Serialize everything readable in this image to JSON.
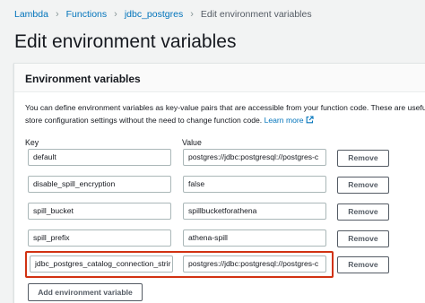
{
  "breadcrumb": {
    "items": [
      "Lambda",
      "Functions",
      "jdbc_postgres"
    ],
    "current": "Edit environment variables",
    "separator": "›"
  },
  "page": {
    "title": "Edit environment variables"
  },
  "panel": {
    "title": "Environment variables",
    "description_line1": "You can define environment variables as key-value pairs that are accessible from your function code. These are useful to",
    "description_line2": "store configuration settings without the need to change function code.",
    "learn_more": "Learn more",
    "key_header": "Key",
    "value_header": "Value",
    "remove_label": "Remove",
    "add_label": "Add environment variable"
  },
  "variables": [
    {
      "key": "default",
      "value": "postgres://jdbc:postgresql://postgres-c"
    },
    {
      "key": "disable_spill_encryption",
      "value": "false"
    },
    {
      "key": "spill_bucket",
      "value": "spillbucketforathena"
    },
    {
      "key": "spill_prefix",
      "value": "athena-spill"
    },
    {
      "key": "jdbc_postgres_catalog_connection_strir",
      "value": "postgres://jdbc:postgresql://postgres-c"
    }
  ],
  "colors": {
    "link": "#0073bb",
    "highlight": "#d13212",
    "button_border": "#545b64"
  }
}
